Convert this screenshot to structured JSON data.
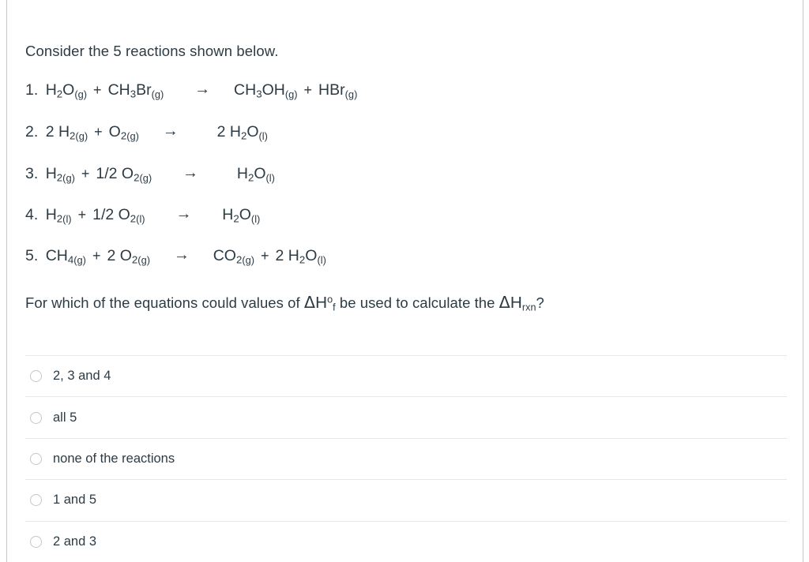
{
  "document": {
    "intro_text": "Consider the 5 reactions shown below.",
    "reactions": [
      {
        "number": "1.",
        "reactants": "H2O(g) + CH3Br(g)",
        "products": "CH3OH(g) + HBr(g)",
        "arrow": "→"
      },
      {
        "number": "2.",
        "reactants": "2 H2(g) + O2(g)",
        "products": "2 H2O(l)",
        "arrow": "→"
      },
      {
        "number": "3.",
        "reactants": "H2(g) + 1/2 O2(g)",
        "products": "H2O(l)",
        "arrow": "→"
      },
      {
        "number": "4.",
        "reactants": "H2(l) + 1/2 O2(l)",
        "products": "H2O(l)",
        "arrow": "→"
      },
      {
        "number": "5.",
        "reactants": "CH4(g) + 2 O2(g)",
        "products": "CO2(g) + 2 H2O(l)",
        "arrow": "→"
      }
    ],
    "prompt": {
      "part1": "For which of the equations could values of ",
      "delta": "Δ",
      "h_f": "H",
      "degree": "o",
      "sub_f": "f",
      "part2": " be used to calculate the ",
      "sub_rxn": "rxn",
      "part3": "?"
    },
    "options": [
      {
        "label": "2, 3 and 4",
        "selected": false
      },
      {
        "label": "all 5",
        "selected": false
      },
      {
        "label": "none of the reactions",
        "selected": false
      },
      {
        "label": "1 and 5",
        "selected": false
      },
      {
        "label": "2 and 3",
        "selected": false
      }
    ]
  },
  "colors": {
    "text": "#2d3b45",
    "separator": "#e8e8e8",
    "radio_border": "#c2c7cb",
    "frame_rule": "#c7c7c7",
    "background": "#ffffff"
  }
}
